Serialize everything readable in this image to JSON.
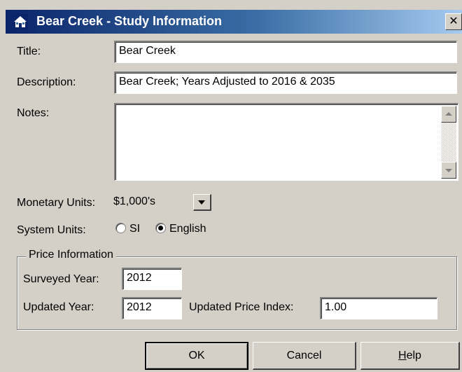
{
  "window": {
    "title": "Bear Creek - Study Information",
    "close_label": "✕"
  },
  "form": {
    "title_label": "Title:",
    "title_value": "Bear Creek",
    "description_label": "Description:",
    "description_value": "Bear Creek; Years Adjusted to 2016 & 2035",
    "notes_label": "Notes:",
    "notes_value": "",
    "monetary_units_label": "Monetary Units:",
    "monetary_units_value": "$1,000's",
    "system_units_label": "System Units:",
    "system_units_options": [
      {
        "label": "SI",
        "selected": false
      },
      {
        "label": "English",
        "selected": true
      }
    ]
  },
  "price_information": {
    "group_label": "Price Information",
    "surveyed_year_label": "Surveyed Year:",
    "surveyed_year_value": "2012",
    "updated_year_label": "Updated Year:",
    "updated_year_value": "2012",
    "updated_price_index_label": "Updated Price Index:",
    "updated_price_index_value": "1.00"
  },
  "buttons": {
    "ok": "OK",
    "cancel": "Cancel",
    "help_mnemonic": "H",
    "help_rest": "elp"
  },
  "colors": {
    "titlebar_start": "#0a246a",
    "titlebar_end": "#a6caf0",
    "dialog_face": "#d4d0c8"
  }
}
